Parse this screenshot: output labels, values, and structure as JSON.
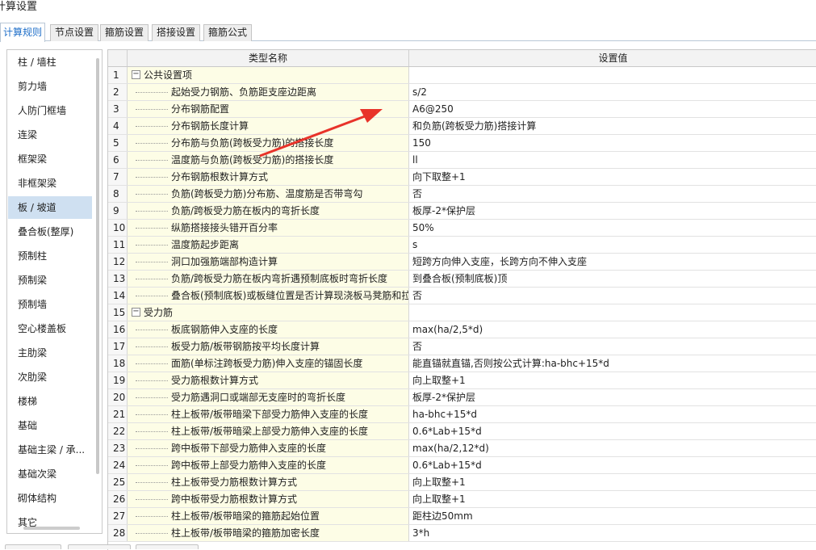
{
  "window": {
    "title": "计算设置"
  },
  "tabs": [
    {
      "label": "计算规则",
      "active": true
    },
    {
      "label": "节点设置",
      "active": false
    },
    {
      "label": "箍筋设置",
      "active": false
    },
    {
      "label": "搭接设置",
      "active": false
    },
    {
      "label": "箍筋公式",
      "active": false
    }
  ],
  "sidebar": {
    "selected": "板 / 坡道",
    "items": [
      "柱 / 墙柱",
      "剪力墙",
      "人防门框墙",
      "连梁",
      "框架梁",
      "非框架梁",
      "板 / 坡道",
      "叠合板(整厚)",
      "预制柱",
      "预制梁",
      "预制墙",
      "空心楼盖板",
      "主肋梁",
      "次肋梁",
      "楼梯",
      "基础",
      "基础主梁 / 承...",
      "基础次梁",
      "砌体结构",
      "其它"
    ]
  },
  "grid": {
    "headers": {
      "name": "类型名称",
      "value": "设置值"
    },
    "rows": [
      {
        "num": "1",
        "name": "公共设置项",
        "value": "",
        "group": true
      },
      {
        "num": "2",
        "name": "起始受力钢筋、负筋距支座边距离",
        "value": "s/2",
        "group": false
      },
      {
        "num": "3",
        "name": "分布钢筋配置",
        "value": "A6@250",
        "group": false
      },
      {
        "num": "4",
        "name": "分布钢筋长度计算",
        "value": "和负筋(跨板受力筋)搭接计算",
        "group": false
      },
      {
        "num": "5",
        "name": "分布筋与负筋(跨板受力筋)的搭接长度",
        "value": "150",
        "group": false
      },
      {
        "num": "6",
        "name": "温度筋与负筋(跨板受力筋)的搭接长度",
        "value": "ll",
        "group": false
      },
      {
        "num": "7",
        "name": "分布钢筋根数计算方式",
        "value": "向下取整+1",
        "group": false
      },
      {
        "num": "8",
        "name": "负筋(跨板受力筋)分布筋、温度筋是否带弯勾",
        "value": "否",
        "group": false
      },
      {
        "num": "9",
        "name": "负筋/跨板受力筋在板内的弯折长度",
        "value": "板厚-2*保护层",
        "group": false
      },
      {
        "num": "10",
        "name": "纵筋搭接接头错开百分率",
        "value": "50%",
        "group": false
      },
      {
        "num": "11",
        "name": "温度筋起步距离",
        "value": "s",
        "group": false
      },
      {
        "num": "12",
        "name": "洞口加强筋端部构造计算",
        "value": "短跨方向伸入支座，长跨方向不伸入支座",
        "group": false
      },
      {
        "num": "13",
        "name": "负筋/跨板受力筋在板内弯折遇预制底板时弯折长度",
        "value": "到叠合板(预制底板)顶",
        "group": false
      },
      {
        "num": "14",
        "name": "叠合板(预制底板)或板缝位置是否计算现浇板马凳筋和拉筋",
        "value": "否",
        "group": false
      },
      {
        "num": "15",
        "name": "受力筋",
        "value": "",
        "group": true
      },
      {
        "num": "16",
        "name": "板底钢筋伸入支座的长度",
        "value": "max(ha/2,5*d)",
        "group": false
      },
      {
        "num": "17",
        "name": "板受力筋/板带钢筋按平均长度计算",
        "value": "否",
        "group": false
      },
      {
        "num": "18",
        "name": "面筋(单标注跨板受力筋)伸入支座的锚固长度",
        "value": "能直锚就直锚,否则按公式计算:ha-bhc+15*d",
        "group": false
      },
      {
        "num": "19",
        "name": "受力筋根数计算方式",
        "value": "向上取整+1",
        "group": false
      },
      {
        "num": "20",
        "name": "受力筋遇洞口或端部无支座时的弯折长度",
        "value": "板厚-2*保护层",
        "group": false
      },
      {
        "num": "21",
        "name": "柱上板带/板带暗梁下部受力筋伸入支座的长度",
        "value": "ha-bhc+15*d",
        "group": false
      },
      {
        "num": "22",
        "name": "柱上板带/板带暗梁上部受力筋伸入支座的长度",
        "value": "0.6*Lab+15*d",
        "group": false
      },
      {
        "num": "23",
        "name": "跨中板带下部受力筋伸入支座的长度",
        "value": "max(ha/2,12*d)",
        "group": false
      },
      {
        "num": "24",
        "name": "跨中板带上部受力筋伸入支座的长度",
        "value": "0.6*Lab+15*d",
        "group": false
      },
      {
        "num": "25",
        "name": "柱上板带受力筋根数计算方式",
        "value": "向上取整+1",
        "group": false
      },
      {
        "num": "26",
        "name": "跨中板带受力筋根数计算方式",
        "value": "向上取整+1",
        "group": false
      },
      {
        "num": "27",
        "name": "柱上板带/板带暗梁的箍筋起始位置",
        "value": "距柱边50mm",
        "group": false
      },
      {
        "num": "28",
        "name": "柱上板带/板带暗梁的箍筋加密长度",
        "value": "3*h",
        "group": false
      }
    ]
  },
  "colors": {
    "accent": "#1f6fc9",
    "selection": "#cfe0f1",
    "name_cell": "#fdfde6",
    "annotation_arrow": "#e8332a"
  },
  "icons": {
    "group_toggle": "collapse-minus-icon",
    "annotation": "red-arrow-icon"
  }
}
